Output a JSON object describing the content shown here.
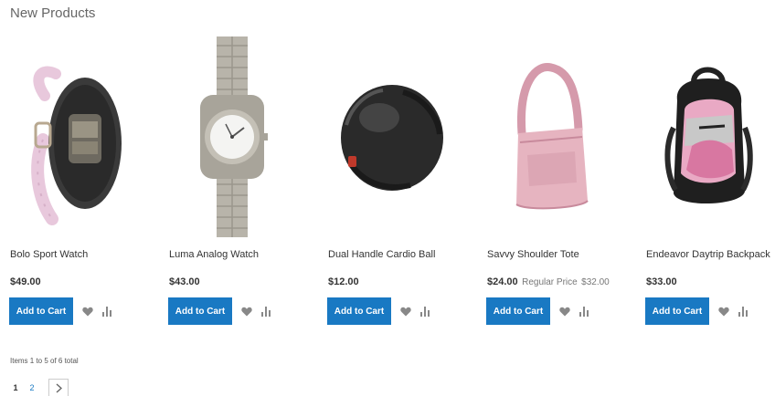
{
  "section": {
    "title": "New Products"
  },
  "products": [
    {
      "name": "Bolo Sport Watch",
      "price": "$49.00",
      "add_to_cart": "Add to Cart",
      "image_icon": "sport-watch-icon"
    },
    {
      "name": "Luma Analog Watch",
      "price": "$43.00",
      "add_to_cart": "Add to Cart",
      "image_icon": "analog-watch-icon"
    },
    {
      "name": "Dual Handle Cardio Ball",
      "price": "$12.00",
      "add_to_cart": "Add to Cart",
      "image_icon": "cardio-ball-icon"
    },
    {
      "name": "Savvy Shoulder Tote",
      "price": "$24.00",
      "old_price_label": "Regular Price",
      "old_price": "$32.00",
      "add_to_cart": "Add to Cart",
      "image_icon": "shoulder-tote-icon"
    },
    {
      "name": "Endeavor Daytrip Backpack",
      "price": "$33.00",
      "add_to_cart": "Add to Cart",
      "image_icon": "backpack-icon"
    }
  ],
  "toolbar": {
    "amount": "Items 1 to 5 of 6 total",
    "pages": [
      "1",
      "2"
    ],
    "current_page": "1",
    "next_icon": "chevron-right-icon"
  },
  "colors": {
    "primary_button": "#1979c3",
    "link": "#1979c3",
    "icon_gray": "#888888"
  }
}
